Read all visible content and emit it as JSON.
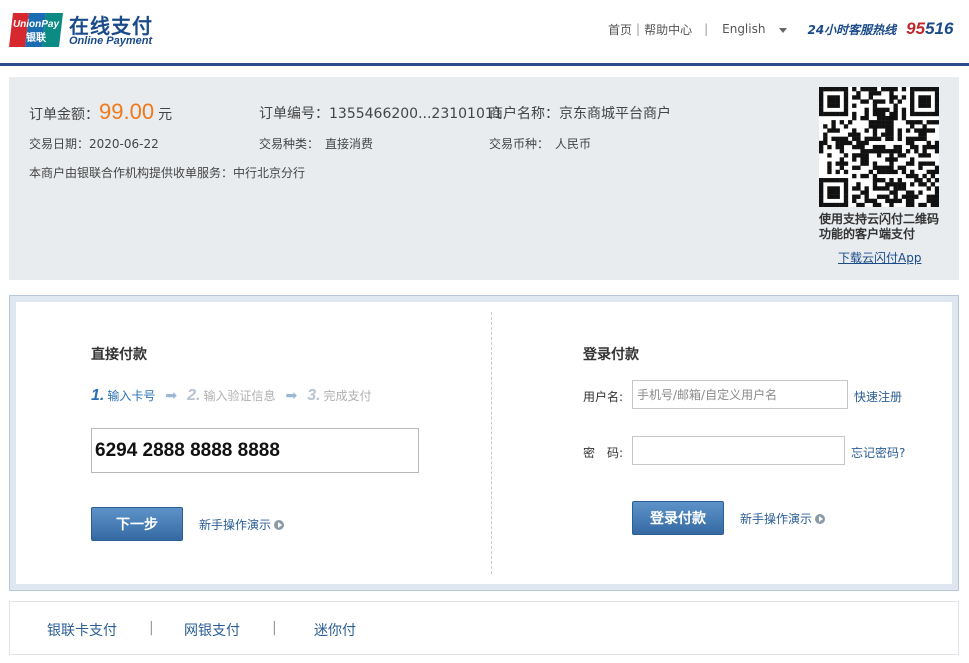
{
  "header": {
    "logo_small": "UnionPay",
    "logo_small_cn": "银联",
    "logo_cn": "在线支付",
    "logo_en": "Online Payment",
    "nav": {
      "home": "首页",
      "help": "帮助中心",
      "language": "English"
    },
    "hotline_label": "24小时客服热线",
    "hotline_number_red": "95",
    "hotline_number_blue": "516"
  },
  "order": {
    "amount_label": "订单金额：",
    "amount_value": "99.00",
    "amount_unit": "元",
    "order_no_label": "订单编号：",
    "order_no_value": "1355466200...23101011",
    "merchant_label": "商户名称：",
    "merchant_value": "京东商城平台商户",
    "date_label": "交易日期：",
    "date_value": "2020-06-22",
    "type_label": "交易种类：",
    "type_value": "直接消费",
    "currency_label": "交易币种：",
    "currency_value": "人民币",
    "acquirer_note": "本商户由银联合作机构提供收单服务：中行北京分行",
    "qr_caption": "使用支持云闪付二维码功能的客户端支付",
    "download_link": "下载云闪付App"
  },
  "direct_pay": {
    "title": "直接付款",
    "steps": [
      {
        "num": "1.",
        "label": "输入卡号"
      },
      {
        "num": "2.",
        "label": "输入验证信息"
      },
      {
        "num": "3.",
        "label": "完成支付"
      }
    ],
    "card_number": "6294 2888 8888 8888",
    "next_button": "下一步",
    "demo_link": "新手操作演示"
  },
  "login_pay": {
    "title": "登录付款",
    "username_label": "用户名:",
    "username_placeholder": "手机号/邮箱/自定义用户名",
    "register_link": "快速注册",
    "password_label": "密　码:",
    "forgot_link": "忘记密码?",
    "login_button": "登录付款",
    "demo_link": "新手操作演示"
  },
  "bottom_tabs": {
    "items": [
      "银联卡支付",
      "网银支付",
      "迷你付"
    ],
    "separator": "|"
  },
  "colors": {
    "brand_blue": "#1a4a8a",
    "amount_orange": "#f07818",
    "button_blue": "#3569a3",
    "hotline_red": "#c0282d"
  }
}
